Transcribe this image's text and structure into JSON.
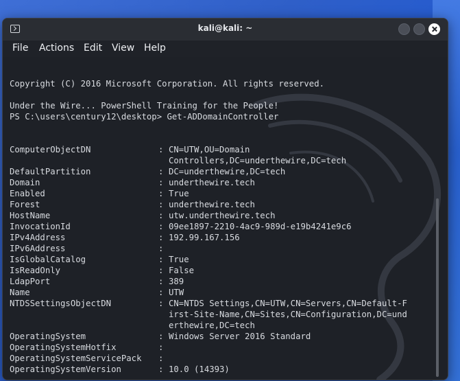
{
  "window": {
    "title": "kali@kali: ~"
  },
  "menu": [
    "File",
    "Actions",
    "Edit",
    "View",
    "Help"
  ],
  "terminal": {
    "copyright": "Copyright (C) 2016 Microsoft Corporation. All rights reserved.",
    "banner": "Under the Wire... PowerShell Training for the People!",
    "prompt": "PS C:\\users\\century12\\desktop> Get-ADDomainController",
    "properties": [
      {
        "name": "ComputerObjectDN",
        "sep": ":",
        "value": "CN=UTW,OU=Domain",
        "cont": [
          "Controllers,DC=underthewire,DC=tech"
        ]
      },
      {
        "name": "DefaultPartition",
        "sep": ":",
        "value": "DC=underthewire,DC=tech"
      },
      {
        "name": "Domain",
        "sep": ":",
        "value": "underthewire.tech"
      },
      {
        "name": "Enabled",
        "sep": ":",
        "value": "True"
      },
      {
        "name": "Forest",
        "sep": ":",
        "value": "underthewire.tech"
      },
      {
        "name": "HostName",
        "sep": ":",
        "value": "utw.underthewire.tech"
      },
      {
        "name": "InvocationId",
        "sep": ":",
        "value": "09ee1897-2210-4ac9-989d-e19b4241e9c6"
      },
      {
        "name": "IPv4Address",
        "sep": ":",
        "value": "192.99.167.156"
      },
      {
        "name": "IPv6Address",
        "sep": ":",
        "value": ""
      },
      {
        "name": "IsGlobalCatalog",
        "sep": ":",
        "value": "True"
      },
      {
        "name": "IsReadOnly",
        "sep": ":",
        "value": "False"
      },
      {
        "name": "LdapPort",
        "sep": ":",
        "value": "389"
      },
      {
        "name": "Name",
        "sep": ":",
        "value": "UTW"
      },
      {
        "name": "NTDSSettingsObjectDN",
        "sep": ":",
        "value": "CN=NTDS Settings,CN=UTW,CN=Servers,CN=Default-F",
        "cont": [
          "irst-Site-Name,CN=Sites,CN=Configuration,DC=und",
          "erthewire,DC=tech"
        ]
      },
      {
        "name": "OperatingSystem",
        "sep": ":",
        "value": "Windows Server 2016 Standard"
      },
      {
        "name": "OperatingSystemHotfix",
        "sep": ":",
        "value": ""
      },
      {
        "name": "OperatingSystemServicePack",
        "sep": ":",
        "value": ""
      },
      {
        "name": "OperatingSystemVersion",
        "sep": ":",
        "value": "10.0 (14393)"
      }
    ]
  },
  "colors": {
    "background": "#1e2127",
    "text": "#d8dbe0",
    "titlebar": "#2a2d33"
  },
  "icons": {
    "app": "terminal-icon",
    "minimize": "minimize-icon",
    "maximize": "maximize-icon",
    "close": "close-icon"
  }
}
